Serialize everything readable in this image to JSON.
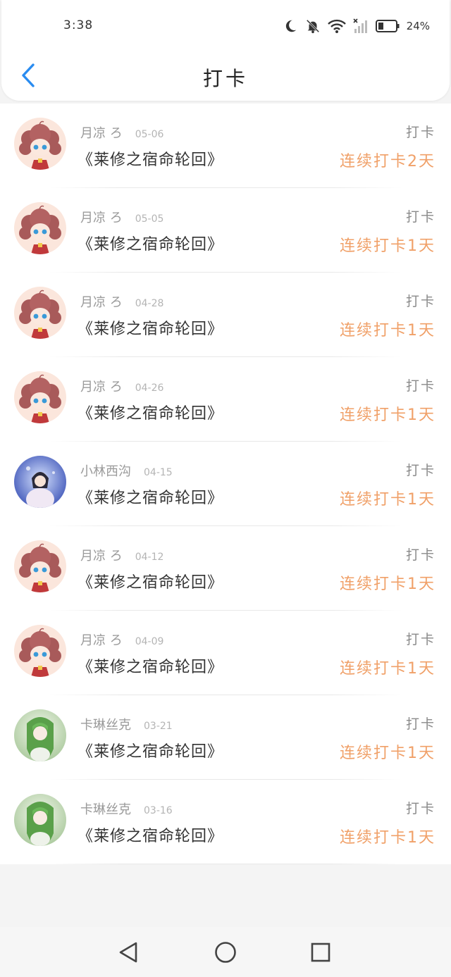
{
  "status_bar": {
    "time": "3:38",
    "battery_percent": "24%",
    "icons": [
      "moon-icon",
      "bell-off-icon",
      "wifi-icon",
      "signal-off-icon",
      "battery-icon"
    ]
  },
  "header": {
    "title": "打卡",
    "back_icon": "chevron-left-icon"
  },
  "entries": [
    {
      "user": "月凉 ろ",
      "date": "05-06",
      "book": "《莱修之宿命轮回》",
      "label": "打卡",
      "streak": "连续打卡2天",
      "avatar": "anime-girl-brown"
    },
    {
      "user": "月凉 ろ",
      "date": "05-05",
      "book": "《莱修之宿命轮回》",
      "label": "打卡",
      "streak": "连续打卡1天",
      "avatar": "anime-girl-brown"
    },
    {
      "user": "月凉 ろ",
      "date": "04-28",
      "book": "《莱修之宿命轮回》",
      "label": "打卡",
      "streak": "连续打卡1天",
      "avatar": "anime-girl-brown"
    },
    {
      "user": "月凉 ろ",
      "date": "04-26",
      "book": "《莱修之宿命轮回》",
      "label": "打卡",
      "streak": "连续打卡1天",
      "avatar": "anime-girl-brown"
    },
    {
      "user": "小林西沟",
      "date": "04-15",
      "book": "《莱修之宿命轮回》",
      "label": "打卡",
      "streak": "连续打卡1天",
      "avatar": "fairy-blue"
    },
    {
      "user": "月凉 ろ",
      "date": "04-12",
      "book": "《莱修之宿命轮回》",
      "label": "打卡",
      "streak": "连续打卡1天",
      "avatar": "anime-girl-brown"
    },
    {
      "user": "月凉 ろ",
      "date": "04-09",
      "book": "《莱修之宿命轮回》",
      "label": "打卡",
      "streak": "连续打卡1天",
      "avatar": "anime-girl-brown"
    },
    {
      "user": "卡琳丝克",
      "date": "03-21",
      "book": "《莱修之宿命轮回》",
      "label": "打卡",
      "streak": "连续打卡1天",
      "avatar": "anime-girl-green"
    },
    {
      "user": "卡琳丝克",
      "date": "03-16",
      "book": "《莱修之宿命轮回》",
      "label": "打卡",
      "streak": "连续打卡1天",
      "avatar": "anime-girl-green"
    }
  ],
  "nav_bar": {
    "buttons": [
      "back-triangle-icon",
      "home-circle-icon",
      "recents-square-icon"
    ]
  },
  "colors": {
    "accent_blue": "#2a8cf0",
    "streak_orange": "#f0a068",
    "meta_gray": "#9a9a9a"
  }
}
